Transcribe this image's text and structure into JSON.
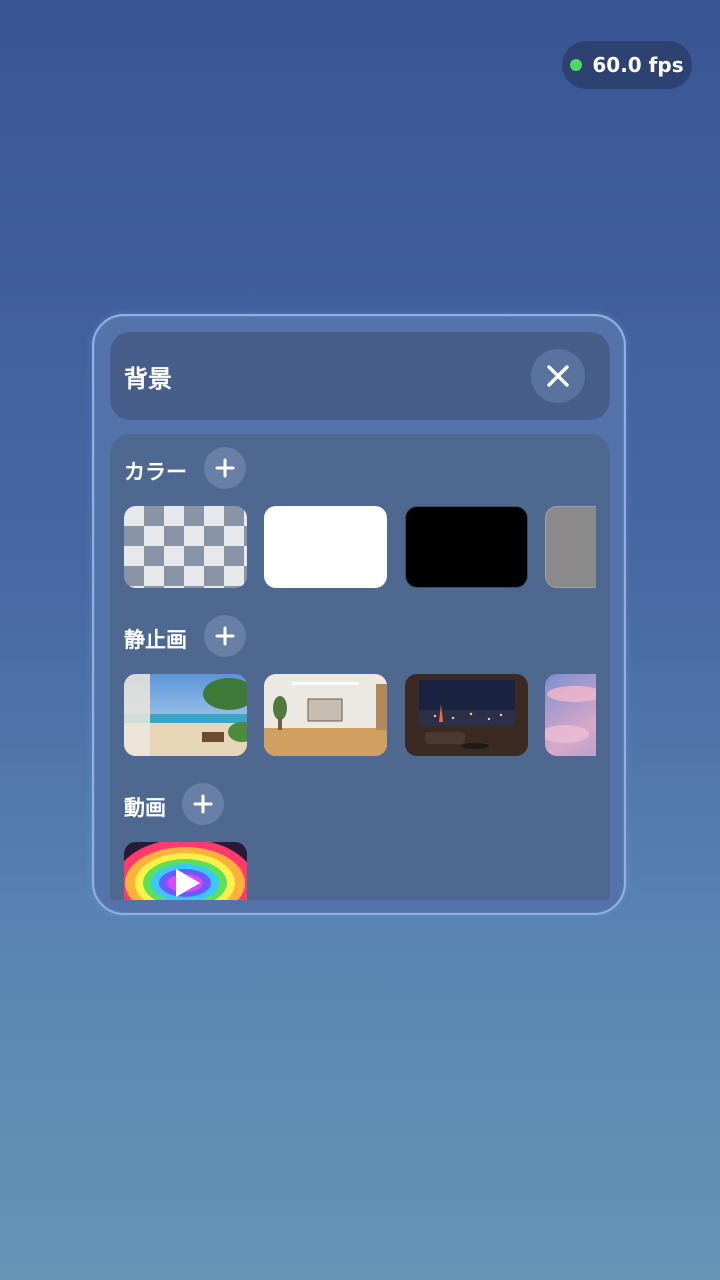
{
  "status": {
    "fps_text": "60.0 fps",
    "indicator_color": "#4cd964"
  },
  "panel": {
    "title": "背景",
    "close_icon": "close-icon",
    "sections": {
      "color": {
        "label": "カラー",
        "add_icon": "plus-icon",
        "items": [
          {
            "name": "transparent",
            "kind": "checkerboard"
          },
          {
            "name": "white",
            "color": "#ffffff"
          },
          {
            "name": "black",
            "color": "#000000"
          },
          {
            "name": "gray",
            "color": "#8a8a8a"
          }
        ]
      },
      "still_image": {
        "label": "静止画",
        "add_icon": "plus-icon",
        "items": [
          {
            "name": "beach-scene"
          },
          {
            "name": "white-room"
          },
          {
            "name": "night-city-view"
          },
          {
            "name": "pink-sky"
          }
        ]
      },
      "video": {
        "label": "動画",
        "add_icon": "plus-icon",
        "items": [
          {
            "name": "rainbow-swirl-video",
            "overlay_icon": "play-icon"
          }
        ]
      }
    }
  }
}
